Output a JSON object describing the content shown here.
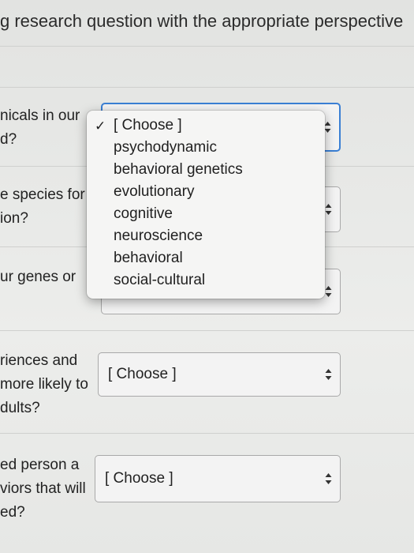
{
  "header": {
    "instruction": "g research question with the appropriate perspective"
  },
  "questions": [
    {
      "lines": [
        "nicals in our",
        "d?"
      ]
    },
    {
      "lines": [
        "e species for",
        "ion?"
      ]
    },
    {
      "lines": [
        "ur genes or"
      ]
    },
    {
      "lines": [
        "riences and",
        "more likely to",
        "dults?"
      ]
    },
    {
      "lines": [
        "ed person a",
        "viors that will",
        "ed?"
      ]
    }
  ],
  "selects": [
    {
      "value": ""
    },
    {
      "value": ""
    },
    {
      "value": ""
    },
    {
      "value": "[ Choose ]"
    },
    {
      "value": "[ Choose ]"
    }
  ],
  "dropdown": {
    "checkmark": "✓",
    "options": [
      {
        "label": "[ Choose ]",
        "selected": true
      },
      {
        "label": "psychodynamic",
        "selected": false
      },
      {
        "label": "behavioral genetics",
        "selected": false
      },
      {
        "label": "evolutionary",
        "selected": false
      },
      {
        "label": "cognitive",
        "selected": false
      },
      {
        "label": "neuroscience",
        "selected": false
      },
      {
        "label": "behavioral",
        "selected": false
      },
      {
        "label": "social-cultural",
        "selected": false
      }
    ]
  },
  "colors": {
    "focus_ring": "#3a7fd4",
    "page_bg": "#e4e5e3"
  }
}
